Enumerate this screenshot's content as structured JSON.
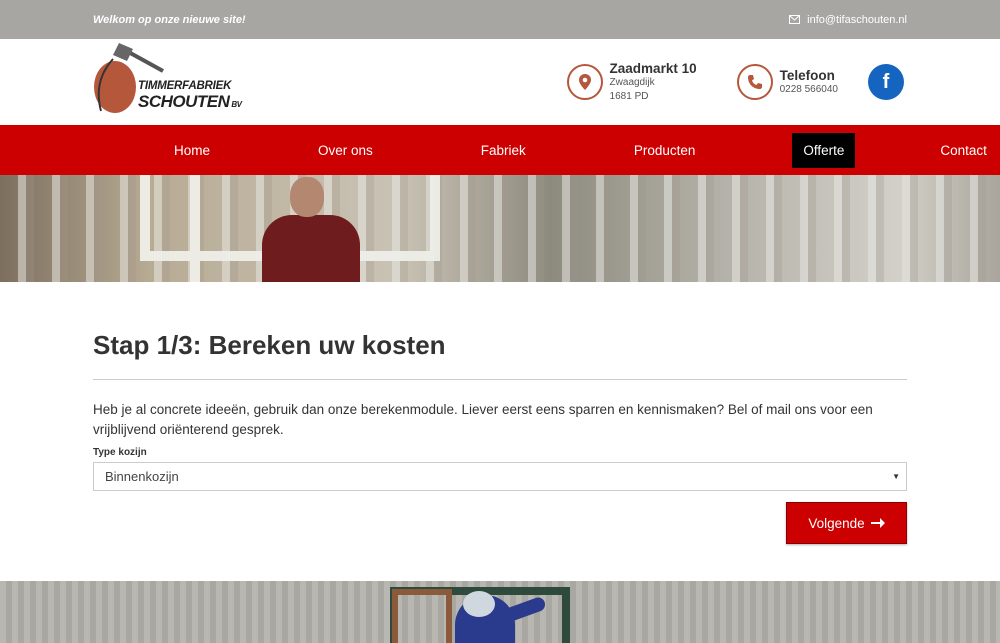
{
  "topbar": {
    "welcome": "Welkom op onze nieuwe site!",
    "email": "info@tifaschouten.nl"
  },
  "logo": {
    "line1": "TIMMERFABRIEK",
    "line2": "SCHOUTEN",
    "suffix": "BV"
  },
  "address": {
    "title": "Zaadmarkt 10",
    "line1": "Zwaagdijk",
    "line2": "1681 PD"
  },
  "phone": {
    "title": "Telefoon",
    "number": "0228 566040"
  },
  "social": {
    "facebook_glyph": "f"
  },
  "nav": {
    "items": [
      {
        "label": "Home"
      },
      {
        "label": "Over ons"
      },
      {
        "label": "Fabriek"
      },
      {
        "label": "Producten"
      },
      {
        "label": "Offerte"
      },
      {
        "label": "Contact"
      }
    ],
    "active": "Offerte"
  },
  "main": {
    "title": "Stap 1/3: Bereken uw kosten",
    "intro": "Heb je al concrete ideeën, gebruik dan onze berekenmodule. Liever eerst eens sparren en kennismaken? Bel of mail ons voor een vrijblijvend oriënterend gesprek.",
    "field_label": "Type kozijn",
    "select_value": "Binnenkozijn",
    "next_button": "Volgende"
  },
  "colors": {
    "brand_red": "#cc0000",
    "topbar_gray": "#a8a6a3",
    "icon_accent": "#b5573b",
    "facebook_blue": "#1565c0"
  }
}
